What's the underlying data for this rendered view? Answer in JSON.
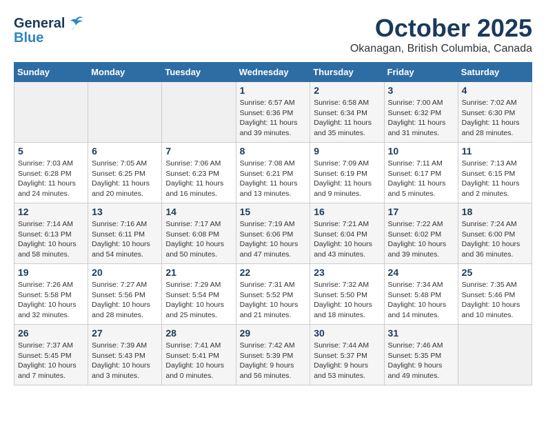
{
  "logo": {
    "line1": "General",
    "line2": "Blue"
  },
  "title": "October 2025",
  "location": "Okanagan, British Columbia, Canada",
  "days_of_week": [
    "Sunday",
    "Monday",
    "Tuesday",
    "Wednesday",
    "Thursday",
    "Friday",
    "Saturday"
  ],
  "weeks": [
    [
      {
        "day": "",
        "info": ""
      },
      {
        "day": "",
        "info": ""
      },
      {
        "day": "",
        "info": ""
      },
      {
        "day": "1",
        "info": "Sunrise: 6:57 AM\nSunset: 6:36 PM\nDaylight: 11 hours\nand 39 minutes."
      },
      {
        "day": "2",
        "info": "Sunrise: 6:58 AM\nSunset: 6:34 PM\nDaylight: 11 hours\nand 35 minutes."
      },
      {
        "day": "3",
        "info": "Sunrise: 7:00 AM\nSunset: 6:32 PM\nDaylight: 11 hours\nand 31 minutes."
      },
      {
        "day": "4",
        "info": "Sunrise: 7:02 AM\nSunset: 6:30 PM\nDaylight: 11 hours\nand 28 minutes."
      }
    ],
    [
      {
        "day": "5",
        "info": "Sunrise: 7:03 AM\nSunset: 6:28 PM\nDaylight: 11 hours\nand 24 minutes."
      },
      {
        "day": "6",
        "info": "Sunrise: 7:05 AM\nSunset: 6:25 PM\nDaylight: 11 hours\nand 20 minutes."
      },
      {
        "day": "7",
        "info": "Sunrise: 7:06 AM\nSunset: 6:23 PM\nDaylight: 11 hours\nand 16 minutes."
      },
      {
        "day": "8",
        "info": "Sunrise: 7:08 AM\nSunset: 6:21 PM\nDaylight: 11 hours\nand 13 minutes."
      },
      {
        "day": "9",
        "info": "Sunrise: 7:09 AM\nSunset: 6:19 PM\nDaylight: 11 hours\nand 9 minutes."
      },
      {
        "day": "10",
        "info": "Sunrise: 7:11 AM\nSunset: 6:17 PM\nDaylight: 11 hours\nand 5 minutes."
      },
      {
        "day": "11",
        "info": "Sunrise: 7:13 AM\nSunset: 6:15 PM\nDaylight: 11 hours\nand 2 minutes."
      }
    ],
    [
      {
        "day": "12",
        "info": "Sunrise: 7:14 AM\nSunset: 6:13 PM\nDaylight: 10 hours\nand 58 minutes."
      },
      {
        "day": "13",
        "info": "Sunrise: 7:16 AM\nSunset: 6:11 PM\nDaylight: 10 hours\nand 54 minutes."
      },
      {
        "day": "14",
        "info": "Sunrise: 7:17 AM\nSunset: 6:08 PM\nDaylight: 10 hours\nand 50 minutes."
      },
      {
        "day": "15",
        "info": "Sunrise: 7:19 AM\nSunset: 6:06 PM\nDaylight: 10 hours\nand 47 minutes."
      },
      {
        "day": "16",
        "info": "Sunrise: 7:21 AM\nSunset: 6:04 PM\nDaylight: 10 hours\nand 43 minutes."
      },
      {
        "day": "17",
        "info": "Sunrise: 7:22 AM\nSunset: 6:02 PM\nDaylight: 10 hours\nand 39 minutes."
      },
      {
        "day": "18",
        "info": "Sunrise: 7:24 AM\nSunset: 6:00 PM\nDaylight: 10 hours\nand 36 minutes."
      }
    ],
    [
      {
        "day": "19",
        "info": "Sunrise: 7:26 AM\nSunset: 5:58 PM\nDaylight: 10 hours\nand 32 minutes."
      },
      {
        "day": "20",
        "info": "Sunrise: 7:27 AM\nSunset: 5:56 PM\nDaylight: 10 hours\nand 28 minutes."
      },
      {
        "day": "21",
        "info": "Sunrise: 7:29 AM\nSunset: 5:54 PM\nDaylight: 10 hours\nand 25 minutes."
      },
      {
        "day": "22",
        "info": "Sunrise: 7:31 AM\nSunset: 5:52 PM\nDaylight: 10 hours\nand 21 minutes."
      },
      {
        "day": "23",
        "info": "Sunrise: 7:32 AM\nSunset: 5:50 PM\nDaylight: 10 hours\nand 18 minutes."
      },
      {
        "day": "24",
        "info": "Sunrise: 7:34 AM\nSunset: 5:48 PM\nDaylight: 10 hours\nand 14 minutes."
      },
      {
        "day": "25",
        "info": "Sunrise: 7:35 AM\nSunset: 5:46 PM\nDaylight: 10 hours\nand 10 minutes."
      }
    ],
    [
      {
        "day": "26",
        "info": "Sunrise: 7:37 AM\nSunset: 5:45 PM\nDaylight: 10 hours\nand 7 minutes."
      },
      {
        "day": "27",
        "info": "Sunrise: 7:39 AM\nSunset: 5:43 PM\nDaylight: 10 hours\nand 3 minutes."
      },
      {
        "day": "28",
        "info": "Sunrise: 7:41 AM\nSunset: 5:41 PM\nDaylight: 10 hours\nand 0 minutes."
      },
      {
        "day": "29",
        "info": "Sunrise: 7:42 AM\nSunset: 5:39 PM\nDaylight: 9 hours\nand 56 minutes."
      },
      {
        "day": "30",
        "info": "Sunrise: 7:44 AM\nSunset: 5:37 PM\nDaylight: 9 hours\nand 53 minutes."
      },
      {
        "day": "31",
        "info": "Sunrise: 7:46 AM\nSunset: 5:35 PM\nDaylight: 9 hours\nand 49 minutes."
      },
      {
        "day": "",
        "info": ""
      }
    ]
  ]
}
